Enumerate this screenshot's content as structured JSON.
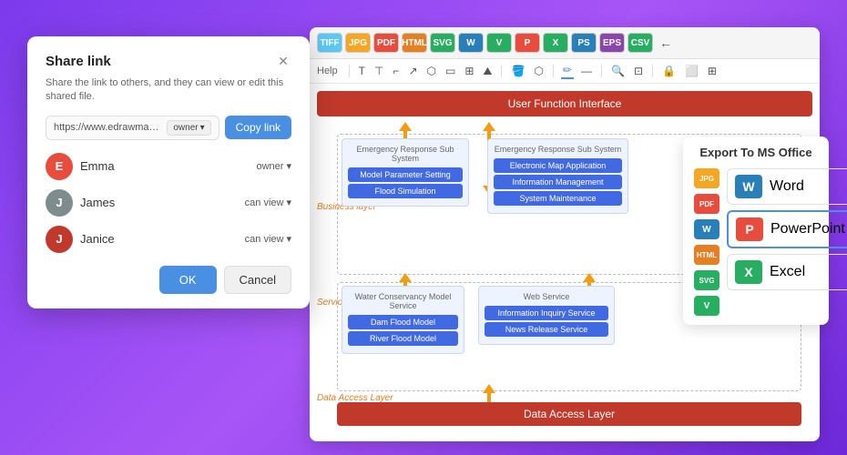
{
  "dialog": {
    "title": "Share link",
    "description": "Share the link to others, and they can view or edit this shared file.",
    "link_url": "https://www.edrawmax.com/online/fil",
    "link_role": "owner",
    "link_role_chevron": "▾",
    "copy_button": "Copy link",
    "users": [
      {
        "id": "emma",
        "name": "Emma",
        "role": "owner",
        "initial": "E",
        "color": "#e74c3c"
      },
      {
        "id": "james",
        "name": "James",
        "role": "can view",
        "initial": "J",
        "color": "#7f8c8d"
      },
      {
        "id": "janice",
        "name": "Janice",
        "role": "can view",
        "initial": "J2",
        "color": "#c0392b"
      }
    ],
    "ok_button": "OK",
    "cancel_button": "Cancel"
  },
  "toolbar": {
    "file_formats": [
      "TIFF",
      "JPG",
      "PDF",
      "HTML",
      "SVG",
      "W",
      "V",
      "P",
      "X",
      "PS",
      "EPS",
      "CSV"
    ],
    "help_label": "Help"
  },
  "diagram": {
    "user_interface_label": "User Function Interface",
    "data_access_label": "Data Access Layer",
    "business_layer": "Business layer",
    "service_layer": "Service Layer",
    "data_access_layer_side": "Data Access Layer",
    "subsystem1_label": "Emergency Response Sub System",
    "subsystem1_btn1": "Model Parameter Setting",
    "subsystem1_btn2": "Flood Simulation",
    "subsystem2_label": "Emergency Response Sub System",
    "subsystem2_btn1": "Electronic Map Application",
    "subsystem2_btn2": "Information Management",
    "subsystem2_btn3": "System Maintenance",
    "service1_label": "Water Conservancy Model Service",
    "service1_btn1": "Dam Flood Model",
    "service1_btn2": "River Flood Model",
    "service2_label": "Web Service",
    "service2_btn1": "Information Inquiry Service",
    "service2_btn2": "News Release Service"
  },
  "export_panel": {
    "title": "Export To MS Office",
    "items": [
      {
        "id": "word",
        "label": "Word",
        "color": "#2980b9",
        "text": "W"
      },
      {
        "id": "powerpoint",
        "label": "PowerPoint",
        "color": "#e74c3c",
        "text": "P",
        "active": true
      },
      {
        "id": "excel",
        "label": "Excel",
        "color": "#27ae60",
        "text": "X"
      }
    ],
    "side_icons": [
      {
        "id": "jpg",
        "color": "#f5a623",
        "text": "JPG"
      },
      {
        "id": "pdf",
        "color": "#e74c3c",
        "text": "PDF"
      },
      {
        "id": "word-sm",
        "color": "#2980b9",
        "text": "W"
      },
      {
        "id": "html",
        "color": "#e67e22",
        "text": "HTML"
      },
      {
        "id": "svg-sm",
        "color": "#27ae60",
        "text": "SVG"
      },
      {
        "id": "v-sm",
        "color": "#27ae60",
        "text": "V"
      }
    ]
  }
}
